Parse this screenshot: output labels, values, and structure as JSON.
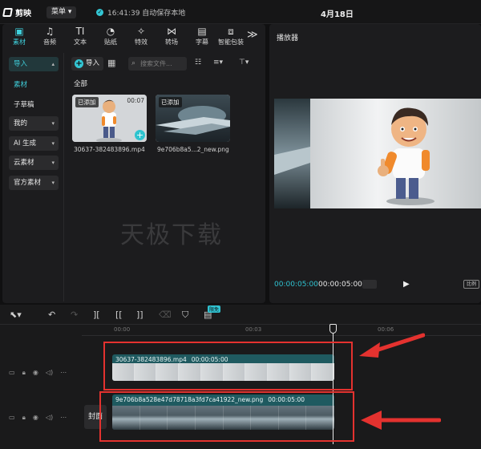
{
  "titlebar": {
    "app_name": "剪映",
    "menu_label": "菜单",
    "save_status": "16:41:39 自动保存本地",
    "project_title": "4月18日"
  },
  "toolbar": {
    "items": [
      {
        "icon": "media-icon",
        "glyph": "▣",
        "label": "素材",
        "active": true
      },
      {
        "icon": "audio-icon",
        "glyph": "♫",
        "label": "音频"
      },
      {
        "icon": "text-icon",
        "glyph": "TI",
        "label": "文本"
      },
      {
        "icon": "sticker-icon",
        "glyph": "◔",
        "label": "贴纸"
      },
      {
        "icon": "effects-icon",
        "glyph": "✧",
        "label": "特效"
      },
      {
        "icon": "transition-icon",
        "glyph": "⋈",
        "label": "转场"
      },
      {
        "icon": "subtitle-icon",
        "glyph": "▤",
        "label": "字幕"
      },
      {
        "icon": "smart-package-icon",
        "glyph": "⧈",
        "label": "智能包装"
      }
    ],
    "more_glyph": "≫"
  },
  "sidebar": {
    "import": "导入",
    "material": "素材",
    "subdraft": "子草稿",
    "mine": "我的",
    "ai_generate": "AI 生成",
    "cloud": "云素材",
    "official": "官方素材"
  },
  "media": {
    "import_label": "导入",
    "search_placeholder": "搜索文件...",
    "all_label": "全部",
    "items": [
      {
        "badge": "已添加",
        "duration": "00:07",
        "name": "30637-382483896.mp4"
      },
      {
        "badge": "已添加",
        "duration": "",
        "name": "9e706b8a5...2_new.png"
      }
    ]
  },
  "watermark": "天极下载",
  "player": {
    "title": "播放器",
    "time_current": "00:00:05:00",
    "time_total": "00:00:05:00",
    "ratio": "比例"
  },
  "timeline": {
    "new_badge": "限免",
    "ticks": [
      "00:00",
      "00:03",
      "00:06"
    ],
    "cover_label": "封面",
    "clips": [
      {
        "name": "30637-382483896.mp4",
        "duration": "00:00:05:00"
      },
      {
        "name": "9e706b8a528e47d78718a3fd7ca41922_new.png",
        "duration": "00:00:05:00"
      }
    ]
  },
  "colors": {
    "accent": "#2fc3d2",
    "annotation_red": "#e4322f",
    "clip_bg": "#1f5a60"
  }
}
